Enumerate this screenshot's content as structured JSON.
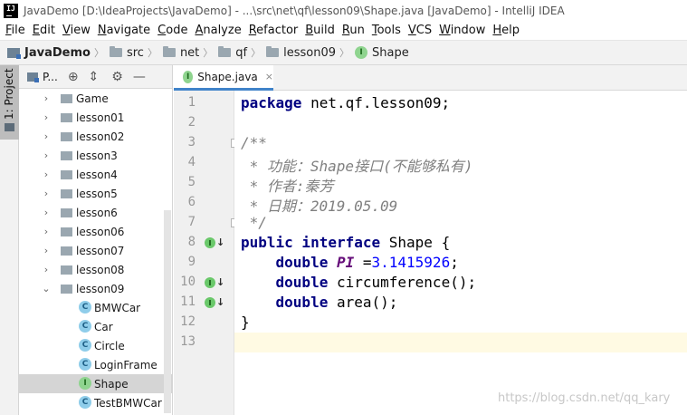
{
  "window": {
    "logo_text": "IJ",
    "title": "JavaDemo [D:\\IdeaProjects\\JavaDemo] - ...\\src\\net\\qf\\lesson09\\Shape.java [JavaDemo] - IntelliJ IDEA"
  },
  "menu": [
    "File",
    "Edit",
    "View",
    "Navigate",
    "Code",
    "Analyze",
    "Refactor",
    "Build",
    "Run",
    "Tools",
    "VCS",
    "Window",
    "Help"
  ],
  "breadcrumb": [
    "JavaDemo",
    "src",
    "net",
    "qf",
    "lesson09",
    "Shape"
  ],
  "tool_window": {
    "tab_label": "1: Project",
    "panel_title": "P...",
    "icons": [
      "locate-icon",
      "collapse-icon",
      "gear-icon",
      "minimize-icon"
    ]
  },
  "tree": [
    {
      "label": "Game",
      "kind": "folder",
      "arrow": "›"
    },
    {
      "label": "lesson01",
      "kind": "folder",
      "arrow": "›"
    },
    {
      "label": "lesson02",
      "kind": "folder",
      "arrow": "›"
    },
    {
      "label": "lesson3",
      "kind": "folder",
      "arrow": "›"
    },
    {
      "label": "lesson4",
      "kind": "folder",
      "arrow": "›"
    },
    {
      "label": "lesson5",
      "kind": "folder",
      "arrow": "›"
    },
    {
      "label": "lesson6",
      "kind": "folder",
      "arrow": "›"
    },
    {
      "label": "lesson06",
      "kind": "folder",
      "arrow": "›"
    },
    {
      "label": "lesson07",
      "kind": "folder",
      "arrow": "›"
    },
    {
      "label": "lesson08",
      "kind": "folder",
      "arrow": "›"
    },
    {
      "label": "lesson09",
      "kind": "folder",
      "arrow": "⌄"
    },
    {
      "label": "BMWCar",
      "kind": "class",
      "icon": "C"
    },
    {
      "label": "Car",
      "kind": "class",
      "icon": "C"
    },
    {
      "label": "Circle",
      "kind": "class",
      "icon": "C"
    },
    {
      "label": "LoginFrame",
      "kind": "class",
      "icon": "C"
    },
    {
      "label": "Shape",
      "kind": "interface",
      "icon": "I",
      "selected": true
    },
    {
      "label": "TestBMWCar",
      "kind": "class",
      "icon": "C"
    }
  ],
  "editor": {
    "tab_label": "Shape.java",
    "tab_close": "×",
    "current_line": 13,
    "lines": [
      {
        "n": "1",
        "tokens": [
          {
            "t": "package ",
            "c": "kw"
          },
          {
            "t": "net.qf.lesson09;",
            "c": ""
          }
        ]
      },
      {
        "n": "2",
        "tokens": []
      },
      {
        "n": "3",
        "tokens": [
          {
            "t": "/**",
            "c": "cm"
          }
        ]
      },
      {
        "n": "4",
        "tokens": [
          {
            "t": " * 功能：Shape接口(不能够私有)",
            "c": "cm"
          }
        ]
      },
      {
        "n": "5",
        "tokens": [
          {
            "t": " * 作者:秦芳",
            "c": "cm"
          }
        ]
      },
      {
        "n": "6",
        "tokens": [
          {
            "t": " * 日期：2019.05.09",
            "c": "cm"
          }
        ]
      },
      {
        "n": "7",
        "tokens": [
          {
            "t": " */",
            "c": "cm"
          }
        ]
      },
      {
        "n": "8",
        "tokens": [
          {
            "t": "public interface ",
            "c": "kw"
          },
          {
            "t": "Shape {",
            "c": ""
          }
        ]
      },
      {
        "n": "9",
        "tokens": [
          {
            "t": "    ",
            "c": ""
          },
          {
            "t": "double ",
            "c": "kw"
          },
          {
            "t": "PI",
            "c": "cf"
          },
          {
            "t": " =",
            "c": ""
          },
          {
            "t": "3.1415926",
            "c": "num"
          },
          {
            "t": ";",
            "c": ""
          }
        ]
      },
      {
        "n": "10",
        "tokens": [
          {
            "t": "    ",
            "c": ""
          },
          {
            "t": "double ",
            "c": "kw"
          },
          {
            "t": "circumference();",
            "c": ""
          }
        ]
      },
      {
        "n": "11",
        "tokens": [
          {
            "t": "    ",
            "c": ""
          },
          {
            "t": "double ",
            "c": "kw"
          },
          {
            "t": "area();",
            "c": ""
          }
        ]
      },
      {
        "n": "12",
        "tokens": [
          {
            "t": "}",
            "c": ""
          }
        ]
      },
      {
        "n": "13",
        "tokens": []
      }
    ],
    "markers": [
      {
        "line": 8,
        "icon": "I",
        "arrow": "↓"
      },
      {
        "line": 10,
        "icon": "I",
        "arrow": "↓"
      },
      {
        "line": 11,
        "icon": "I",
        "arrow": "↓"
      }
    ],
    "folds": [
      3,
      7
    ]
  },
  "watermark": "https://blog.csdn.net/qq_kary"
}
